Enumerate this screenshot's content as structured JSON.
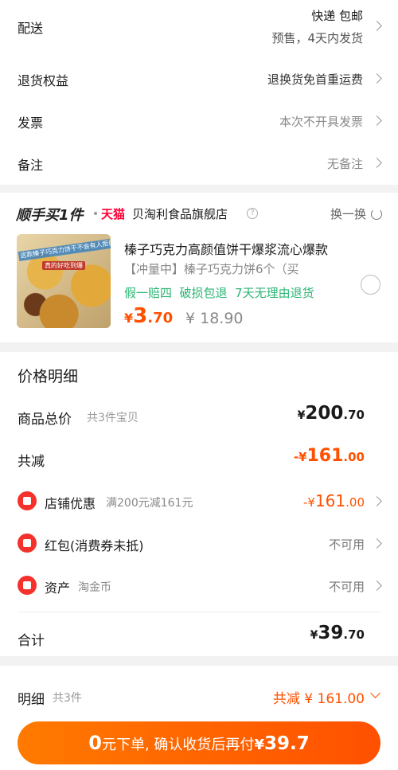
{
  "delivery": {
    "label": "配送",
    "method": "快递 包邮",
    "presale": "预售，4天内发货"
  },
  "return": {
    "label": "退货权益",
    "value": "退换货免首重运费"
  },
  "invoice": {
    "label": "发票",
    "value": "本次不开具发票"
  },
  "remark": {
    "label": "备注",
    "value": "无备注"
  },
  "shop": {
    "brand_tag": "顺手买1件",
    "tmall": "天猫",
    "name": "贝淘利食品旗舰店",
    "swap": "换一换",
    "product_title": "榛子巧克力高颜值饼干爆浆流心爆款",
    "product_sub": "【冲量中】榛子巧克力饼6个（买",
    "guarantee": "假一赔四  破损包退  7天无理由退货",
    "price_symbol": "¥",
    "price_int": "3",
    "price_dec": ".70",
    "orig_price": "¥ 18.90",
    "image_text": "这款榛子巧克力饼干不会有人拒绝吧",
    "image_text2": "真的好吃到爆"
  },
  "price_detail": {
    "title": "价格明细",
    "goods_total_label": "商品总价",
    "goods_count": "共3件宝贝",
    "goods_total_symbol": "¥",
    "goods_total_int": "200",
    "goods_total_dec": ".70",
    "discount_label": "共减",
    "discount_symbol": "-¥",
    "discount_int": "161",
    "discount_dec": ".00",
    "shop_promo_label": "店铺优惠",
    "shop_promo_desc": "满200元减161元",
    "shop_promo_symbol": "-¥",
    "shop_promo_int": "161",
    "shop_promo_dec": ".00",
    "redpack_label": "红包(消费券未抵)",
    "redpack_value": "不可用",
    "asset_label": "资产",
    "asset_desc": "淘金币",
    "asset_value": "不可用",
    "sum_label": "合计",
    "sum_symbol": "¥",
    "sum_int": "39",
    "sum_dec": ".70"
  },
  "bottom": {
    "detail_label": "明细",
    "detail_count": "共3件",
    "total_discount": "共减 ¥ 161.00",
    "button_zero": "0",
    "button_text": "元下单, 确认收货后再付",
    "button_amount_symbol": "¥",
    "button_amount": "39.7"
  },
  "colors": {
    "accent": "#ff5000",
    "button_bg": "#ff5a00",
    "green": "#2bb673",
    "red_icon": "#f5312c"
  }
}
